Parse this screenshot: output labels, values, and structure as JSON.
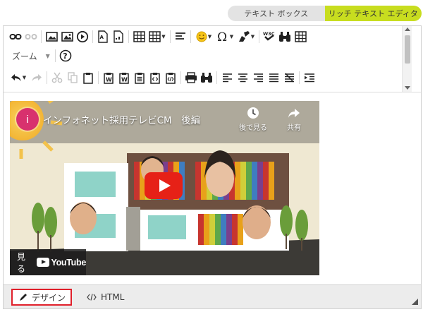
{
  "mode_tabs": {
    "plain_text": "テキスト ボックス",
    "rich_text": "リッチ テキスト エディタ"
  },
  "toolbar": {
    "zoom_label": "ズーム"
  },
  "video": {
    "channel_initial": "i",
    "title": "インフォネット採用テレビCM　後編",
    "watch_later": "後で見る",
    "share": "共有",
    "watch_on": "見る",
    "youtube": "YouTube"
  },
  "view_tabs": {
    "design": "デザイン",
    "html": "HTML"
  },
  "colors": {
    "accent_tab": "#c8dd1f",
    "highlight_border": "#e0202b",
    "youtube_red": "#e62117",
    "channel_avatar": "#d8316e"
  },
  "icons": [
    "link-icon",
    "unlink-icon",
    "image-icon",
    "image-manager-icon",
    "media-icon",
    "flash-icon",
    "document-icon",
    "table-icon",
    "table-dropdown-icon",
    "paragraph-icon",
    "emoji-icon",
    "symbol-icon",
    "format-stripper-icon",
    "w3c-validator-icon",
    "find-icon",
    "module-icon",
    "help-icon",
    "undo-icon",
    "redo-icon",
    "cut-icon",
    "copy-icon",
    "paste-icon",
    "paste-from-word-icon",
    "paste-word-clean-icon",
    "paste-plain-text-icon",
    "paste-as-html-icon",
    "paste-html-icon",
    "print-icon",
    "find-replace-icon",
    "align-left-icon",
    "align-center-icon",
    "align-right-icon",
    "justify-icon",
    "remove-alignment-icon",
    "insert-snippet-icon"
  ]
}
